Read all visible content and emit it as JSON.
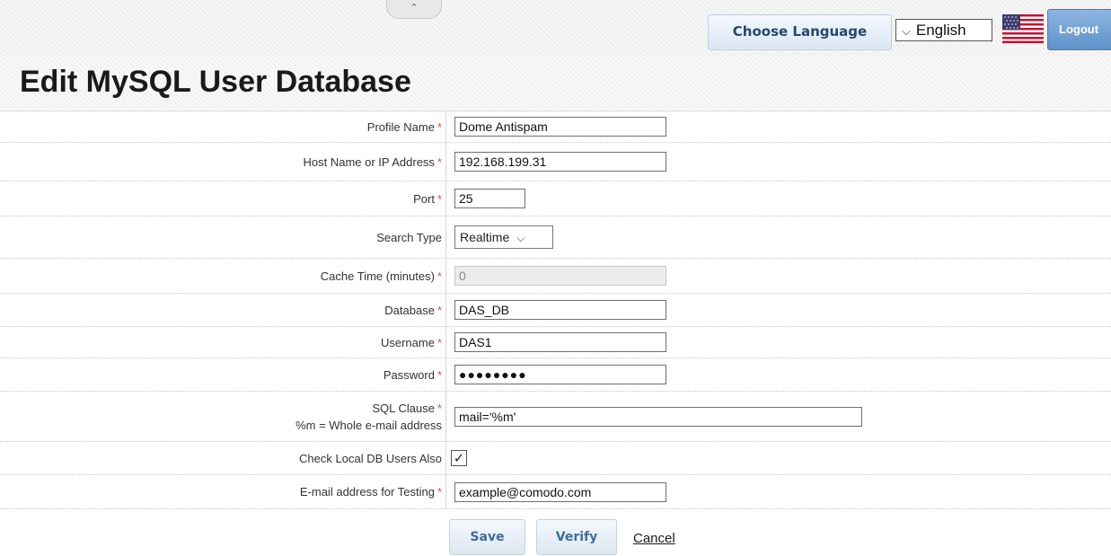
{
  "header": {
    "collapse_glyph": "⌃",
    "choose_language_label": "Choose Language",
    "language_selected": "English",
    "language_chevron": "⌵",
    "flag_icon": "us-flag-icon",
    "logout_label": "Logout"
  },
  "page": {
    "title": "Edit MySQL User Database"
  },
  "form": {
    "required_marker": "*",
    "profile_name": {
      "label": "Profile Name",
      "value": "Dome Antispam"
    },
    "host": {
      "label": "Host Name or IP Address",
      "value": "192.168.199.31"
    },
    "port": {
      "label": "Port",
      "value": "25"
    },
    "search_type": {
      "label": "Search Type",
      "value": "Realtime",
      "chevron": "⌵"
    },
    "cache_time": {
      "label": "Cache Time (minutes)",
      "value": "0"
    },
    "database": {
      "label": "Database",
      "value": "DAS_DB"
    },
    "username": {
      "label": "Username",
      "value": "DAS1"
    },
    "password": {
      "label": "Password",
      "masked": "●●●●●●●●"
    },
    "sql_clause": {
      "label": "SQL Clause",
      "hint": "%m = Whole e-mail address",
      "value": "mail='%m'"
    },
    "check_local": {
      "label": "Check Local DB Users Also",
      "checked": true,
      "check_glyph": "✓"
    },
    "test_email": {
      "label": "E-mail address for Testing",
      "value": "example@comodo.com"
    }
  },
  "actions": {
    "save_label": "Save",
    "verify_label": "Verify",
    "cancel_label": "Cancel"
  },
  "colors": {
    "required": "#e05050",
    "button_text": "#3f6b9b",
    "logout_bg": "#6f9fd2"
  }
}
